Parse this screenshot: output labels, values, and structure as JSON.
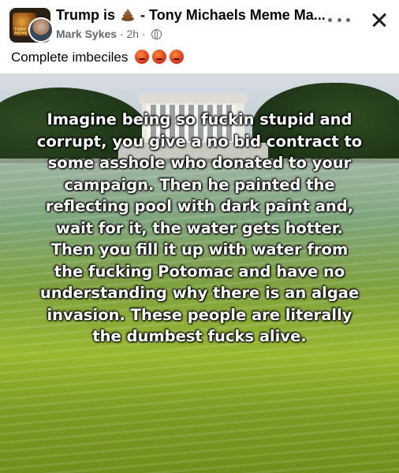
{
  "header": {
    "title": "Trump is",
    "title_rest": "- Tony Michaels Meme Ma...",
    "author": "Mark Sykes",
    "time": "· 2h ·",
    "group_avatar_text": "TONY MICHAELS MEME"
  },
  "post": {
    "caption": "Complete imbeciles",
    "image_text": "Imagine being so fuckin stupid and\ncorrupt, you give a no bid contract to\nsome asshole who donated to your\ncampaign.  Then he painted the\nreflecting pool with dark paint and,\nwait for it, the water gets hotter.\nThen you fill it up with water from\nthe fucking Potomac and have no\nunderstanding why there is an algae\ninvasion.  These people are literally\nthe dumbest fucks alive."
  },
  "icons": [
    "poop-emoji-icon",
    "angry-emoji-icon",
    "globe-icon",
    "more-icon",
    "close-icon"
  ],
  "colors": {
    "secondary_text": "#65676b",
    "angry_emoji": "#e0401c",
    "algae_water": "#98b82f"
  }
}
